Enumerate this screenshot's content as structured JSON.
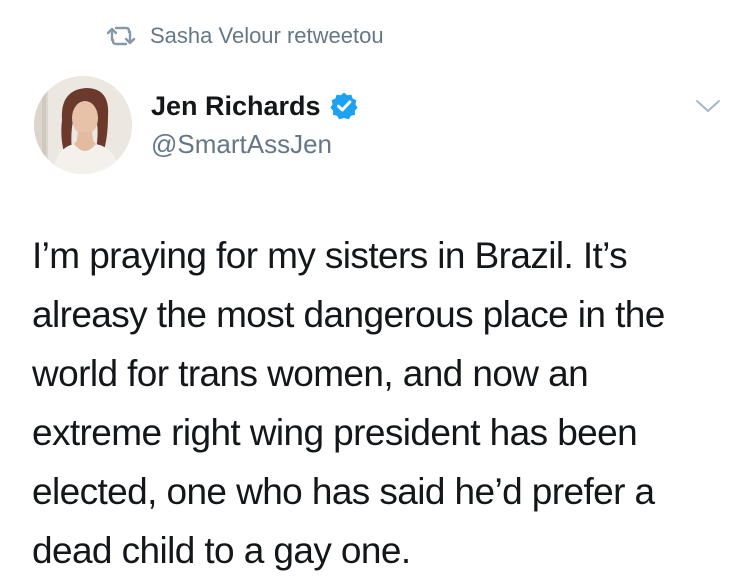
{
  "retweet": {
    "icon": "retweet-icon",
    "text": "Sasha Velour retweetou",
    "color": "#657786"
  },
  "author": {
    "display_name": "Jen Richards",
    "handle": "@SmartAssJen",
    "verified_icon": "verified-badge-icon",
    "verified_color": "#1da1f2"
  },
  "tweet": {
    "text": "I’m praying for my sisters in Brazil. It’s alreasy the most dangerous place in the world for trans women, and now an extreme right wing president has been elected, one who has said he’d prefer a dead child to a gay one."
  },
  "menu": {
    "icon": "chevron-down-icon"
  }
}
